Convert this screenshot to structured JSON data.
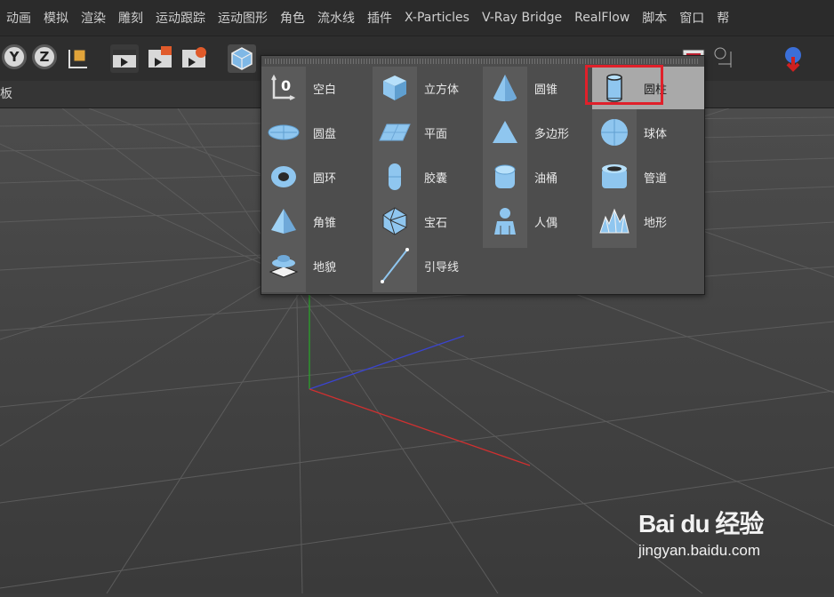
{
  "menu": [
    "动画",
    "模拟",
    "渲染",
    "雕刻",
    "运动跟踪",
    "运动图形",
    "角色",
    "流水线",
    "插件",
    "X-Particles",
    "V-Ray Bridge",
    "RealFlow",
    "脚本",
    "窗口",
    "帮"
  ],
  "toolbar": {
    "y_axis": "Y",
    "z_axis": "Z"
  },
  "panel_label": "板",
  "popup": {
    "columns": [
      [
        {
          "label": "空白",
          "icon": "null-icon"
        },
        {
          "label": "圆盘",
          "icon": "disc-icon"
        },
        {
          "label": "圆环",
          "icon": "torus-icon"
        },
        {
          "label": "角锥",
          "icon": "pyramid-icon"
        },
        {
          "label": "地貌",
          "icon": "landscape-icon"
        }
      ],
      [
        {
          "label": "立方体",
          "icon": "cube-icon"
        },
        {
          "label": "平面",
          "icon": "plane-icon"
        },
        {
          "label": "胶囊",
          "icon": "capsule-icon"
        },
        {
          "label": "宝石",
          "icon": "gem-icon"
        },
        {
          "label": "引导线",
          "icon": "guide-line-icon"
        }
      ],
      [
        {
          "label": "圆锥",
          "icon": "cone-icon"
        },
        {
          "label": "多边形",
          "icon": "polygon-icon"
        },
        {
          "label": "油桶",
          "icon": "oil-tank-icon"
        },
        {
          "label": "人偶",
          "icon": "figure-icon"
        }
      ],
      [
        {
          "label": "圆柱",
          "icon": "cylinder-icon",
          "active": true
        },
        {
          "label": "球体",
          "icon": "sphere-icon"
        },
        {
          "label": "管道",
          "icon": "tube-icon"
        },
        {
          "label": "地形",
          "icon": "terrain-icon"
        }
      ]
    ]
  },
  "watermark": {
    "logo": "Bai du 经验",
    "url": "jingyan.baidu.com"
  }
}
